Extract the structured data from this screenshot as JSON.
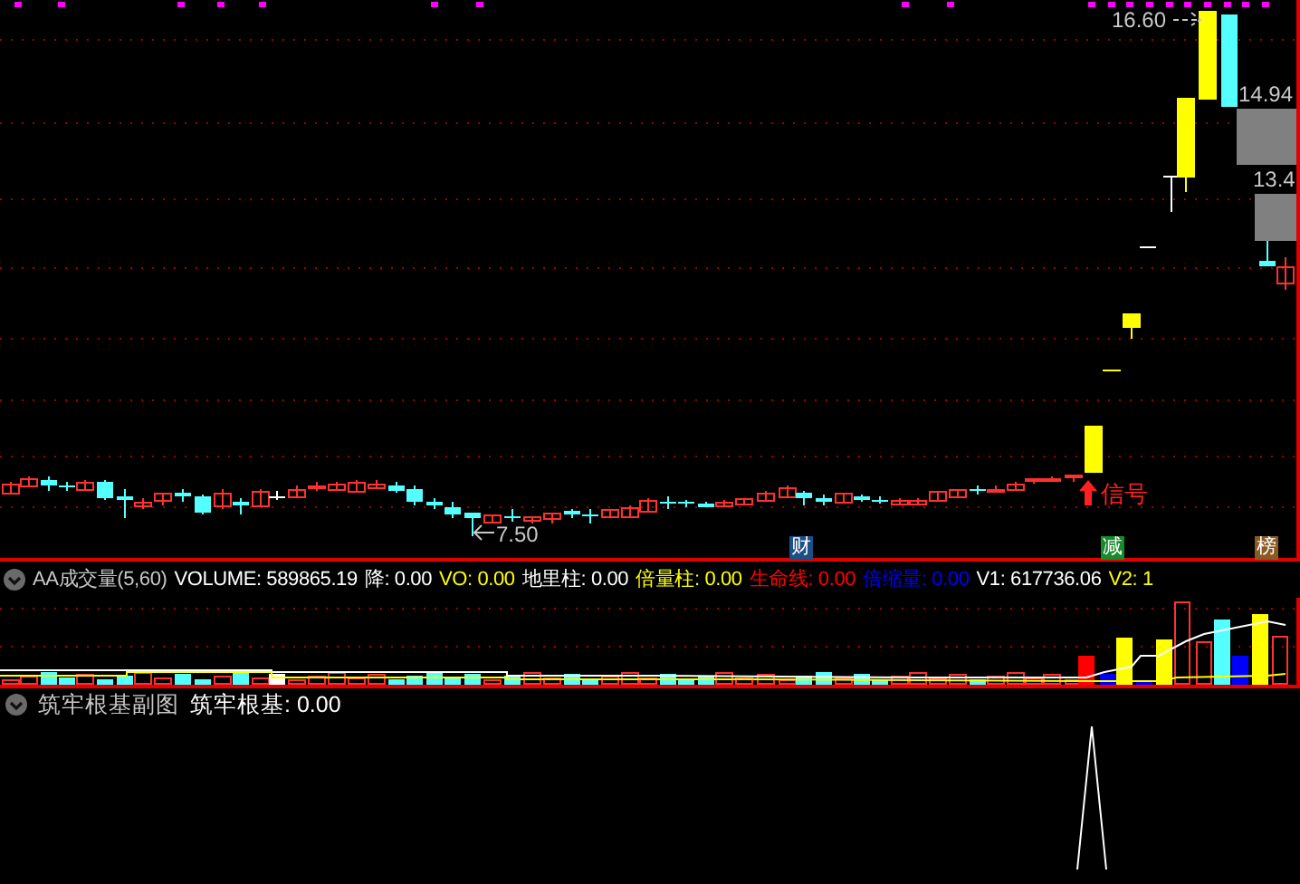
{
  "main_chart": {
    "price_labels": [
      {
        "text": "16.60"
      },
      {
        "text": "14.94"
      },
      {
        "text": "13.4"
      },
      {
        "text": "7.50"
      }
    ],
    "signal": {
      "text": "信号"
    },
    "markers": [
      {
        "text": "财",
        "color": "#1c4f86"
      },
      {
        "text": "减",
        "color": "#178a2a"
      },
      {
        "text": "榜",
        "color": "#8a5a24"
      }
    ]
  },
  "volume_panel": {
    "title": "AA成交量(5,60)",
    "items": [
      {
        "label": "VOLUME:",
        "value": "589865.19",
        "color": "#ffffff"
      },
      {
        "label": "降:",
        "value": "0.00",
        "color": "#ffffff"
      },
      {
        "label": "VO:",
        "value": "0.00",
        "color": "#ffff00"
      },
      {
        "label": "地里柱:",
        "value": "0.00",
        "color": "#ffffff"
      },
      {
        "label": "倍量柱:",
        "value": "0.00",
        "color": "#ffff00"
      },
      {
        "label": "生命线:",
        "value": "0.00",
        "color": "#ff0000"
      },
      {
        "label": "倍缩量:",
        "value": "0.00",
        "color": "#0000ff"
      },
      {
        "label": "V1:",
        "value": "617736.06",
        "color": "#ffffff"
      },
      {
        "label": "V2:",
        "value": "1",
        "color": "#ffff00"
      }
    ]
  },
  "sub_panel": {
    "title": "筑牢根基副图",
    "items": [
      {
        "label": "筑牢根基:",
        "value": "0.00"
      }
    ]
  }
}
